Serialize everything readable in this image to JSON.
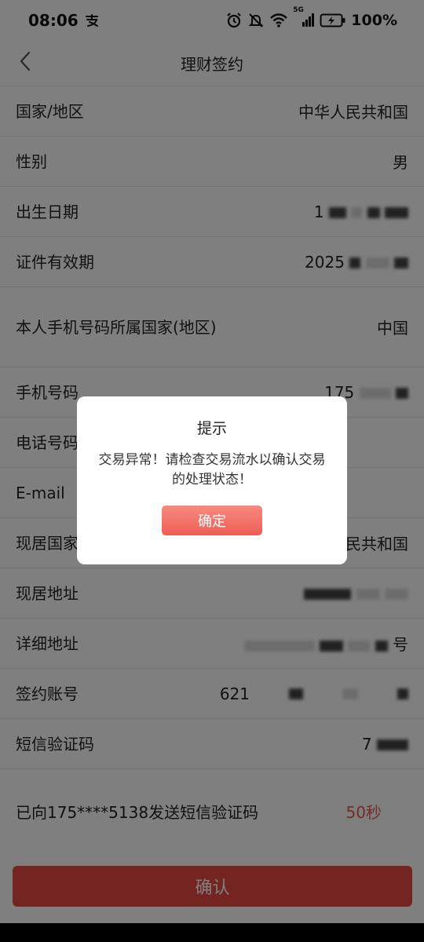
{
  "status_bar": {
    "time": "08:06",
    "battery_percent": "100%",
    "network_type": "5G",
    "icons": [
      "alipay-icon",
      "alarm-icon",
      "mute-icon",
      "wifi-icon",
      "signal-icon",
      "battery-icon"
    ]
  },
  "nav": {
    "title": "理财签约",
    "back_icon": "back-chevron-icon"
  },
  "form": {
    "rows": [
      {
        "label": "国家/地区",
        "value": "中华人民共和国"
      },
      {
        "label": "性别",
        "value": "男"
      },
      {
        "label": "出生日期",
        "value": "1"
      },
      {
        "label": "证件有效期",
        "value": "2025"
      },
      {
        "label": "本人手机号码所属国家(地区)",
        "value": "中国"
      },
      {
        "label": "手机号码",
        "value": "175"
      },
      {
        "label": "电话号码",
        "value": ""
      },
      {
        "label": "E-mail",
        "value": ""
      },
      {
        "label": "现居国家",
        "value": "民共和国"
      },
      {
        "label": "现居地址",
        "value": ""
      },
      {
        "label": "详细地址",
        "value": "号"
      },
      {
        "label": "签约账号",
        "value": "621"
      },
      {
        "label": "短信验证码",
        "value": "7"
      }
    ]
  },
  "sms": {
    "text": "已向175****5138发送短信验证码",
    "countdown": "50秒"
  },
  "submit_label": "确认",
  "dialog": {
    "title": "提示",
    "message": "交易异常！请检查交易流水以确认交易的处理状态！",
    "ok_label": "确定"
  },
  "colors": {
    "accent": "#e84b42",
    "countdown": "#e35b54",
    "overlay": "rgba(0,0,0,0.5)"
  }
}
